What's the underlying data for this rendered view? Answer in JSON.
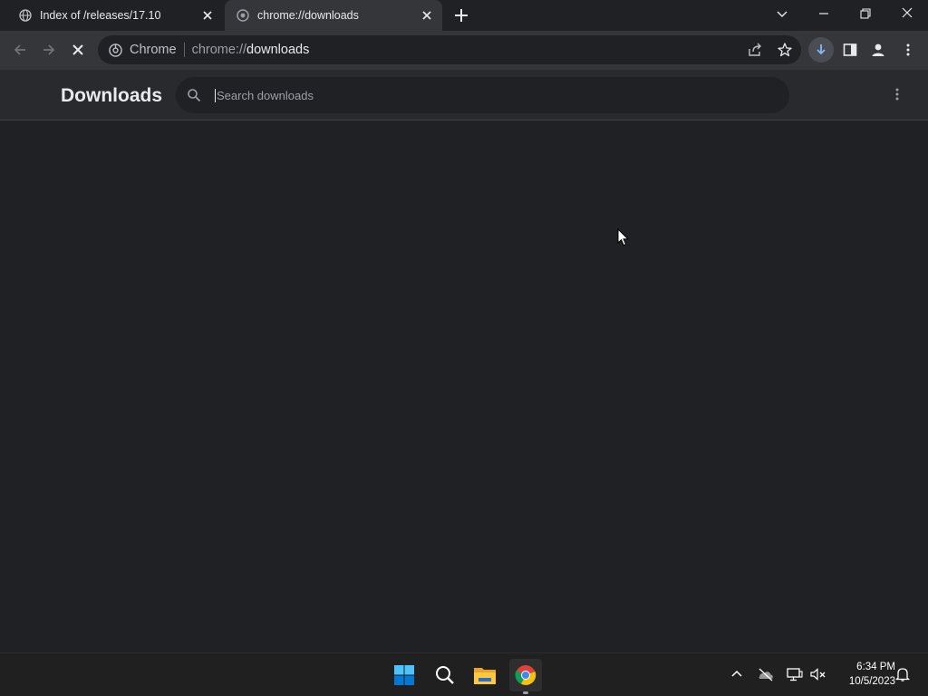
{
  "browser": {
    "tabs": [
      {
        "title": "Index of /releases/17.10",
        "active": false,
        "favicon": "globe-icon"
      },
      {
        "title": "chrome://downloads",
        "active": true,
        "favicon": "chrome-page-icon"
      }
    ],
    "omnibox": {
      "site_label": "Chrome",
      "url_scheme": "chrome://",
      "url_host": "downloads"
    }
  },
  "downloads_page": {
    "title": "Downloads",
    "search": {
      "placeholder": "Search downloads",
      "value": ""
    }
  },
  "taskbar": {
    "time": "6:34 PM",
    "date": "10/5/2023"
  },
  "colors": {
    "background": "#202124",
    "toolbar": "#35363a",
    "header": "#292a2d",
    "taskbar": "#202020",
    "download_active": "#8ab4f8"
  }
}
